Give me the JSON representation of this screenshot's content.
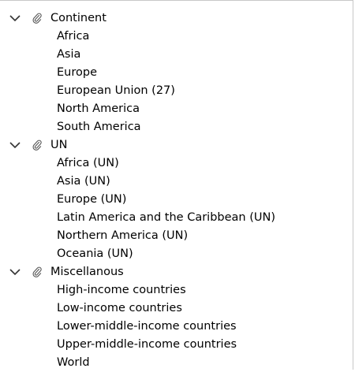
{
  "tree": {
    "groups": [
      {
        "label": "Continent",
        "expanded": true,
        "icon": "paperclip-icon",
        "children": [
          "Africa",
          "Asia",
          "Europe",
          "European Union (27)",
          "North America",
          "South America"
        ]
      },
      {
        "label": "UN",
        "expanded": true,
        "icon": "paperclip-icon",
        "children": [
          "Africa (UN)",
          "Asia (UN)",
          "Europe (UN)",
          "Latin America and the Caribbean (UN)",
          "Northern America (UN)",
          "Oceania (UN)"
        ]
      },
      {
        "label": "Miscellanous",
        "expanded": true,
        "icon": "paperclip-icon",
        "children": [
          "High-income countries",
          "Low-income countries",
          "Lower-middle-income countries",
          "Upper-middle-income countries",
          "World"
        ]
      }
    ]
  },
  "colors": {
    "text": "#000000",
    "icon": "#555555",
    "border": "#c8c8c8",
    "background": "#ffffff"
  }
}
